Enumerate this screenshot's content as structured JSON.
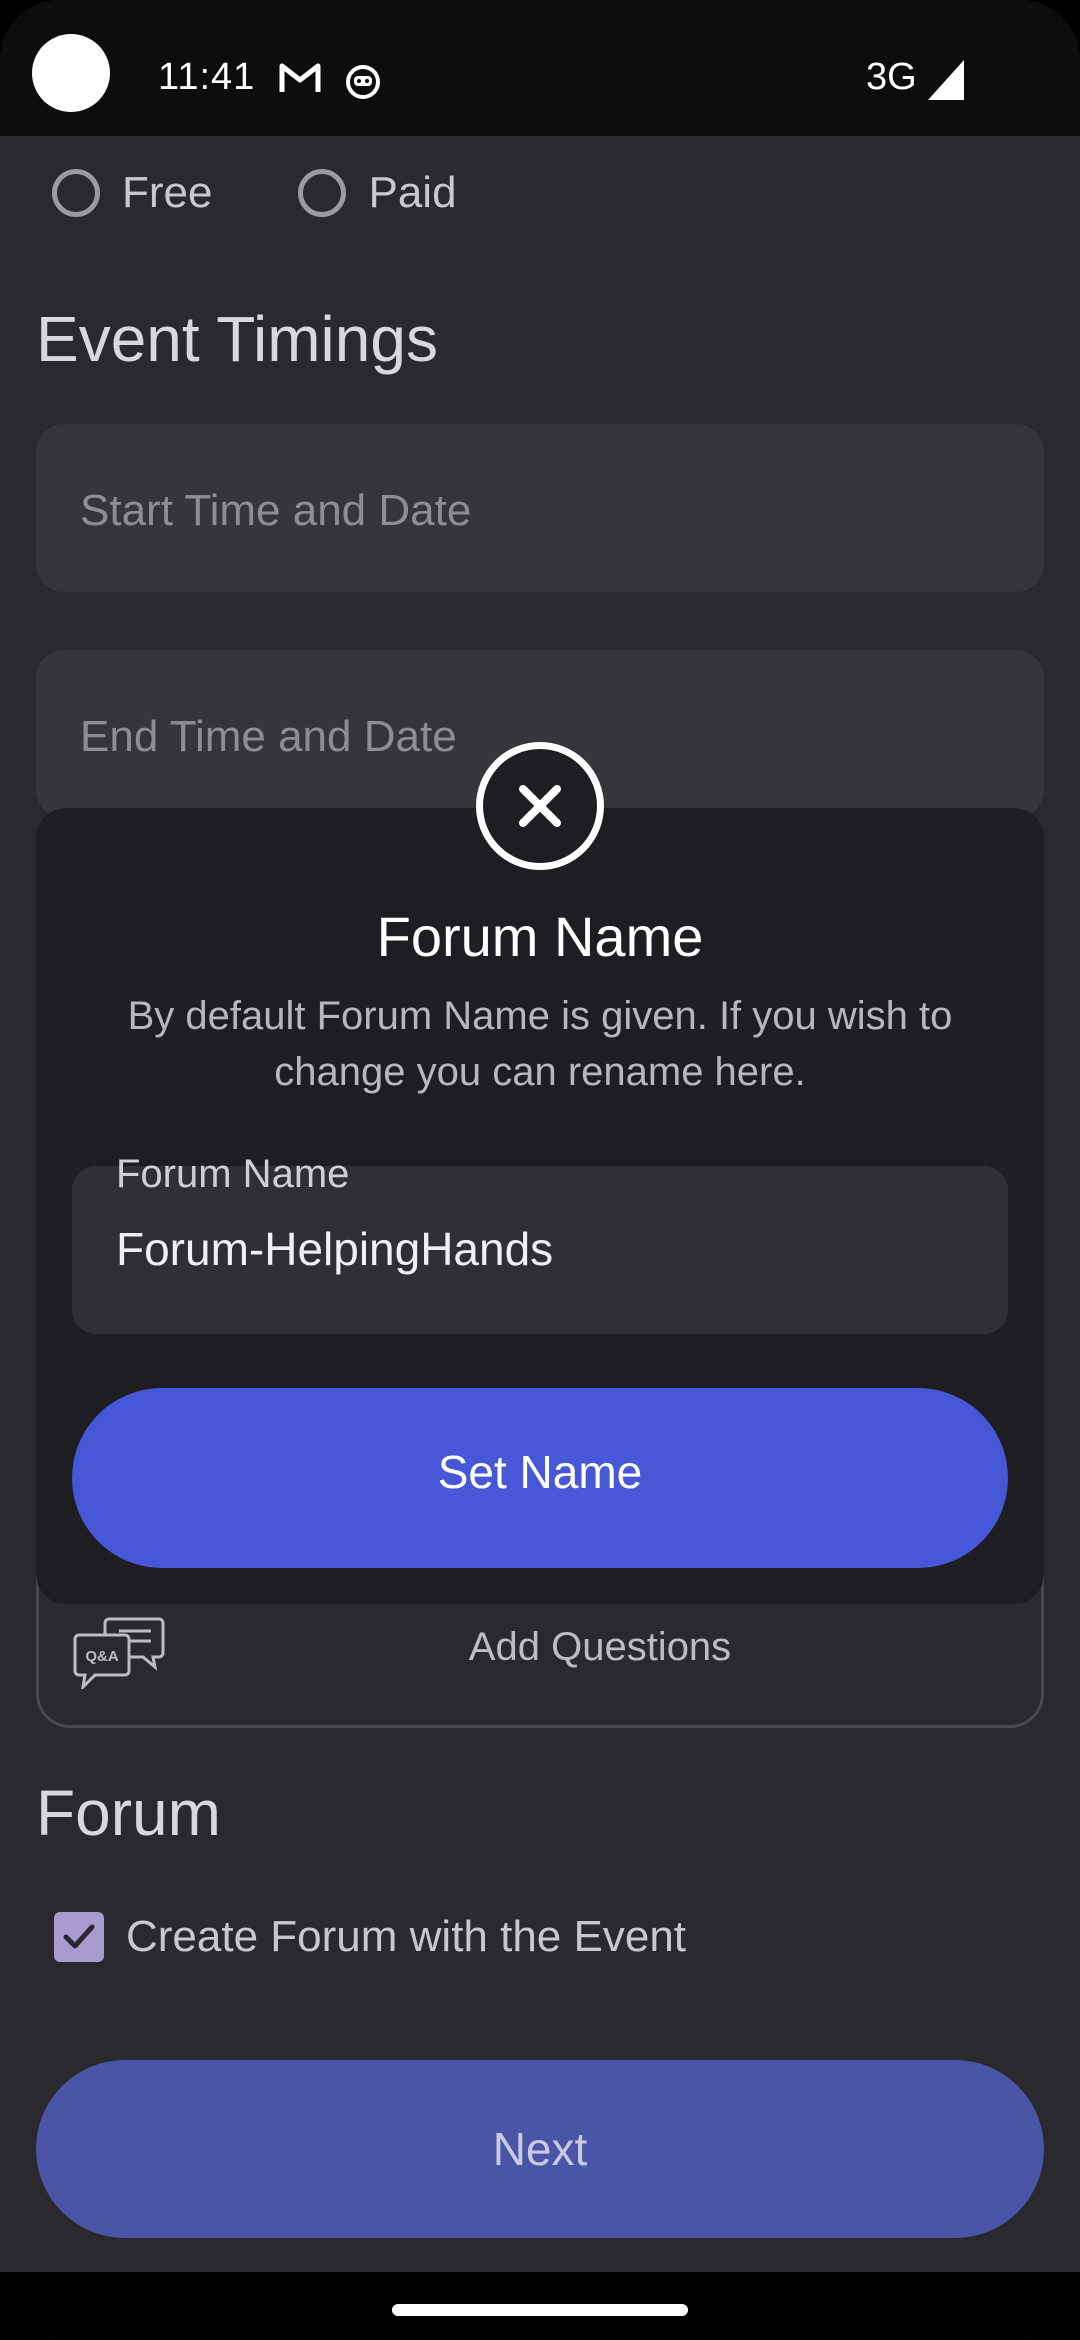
{
  "status_bar": {
    "time": "11:41",
    "network": "3G"
  },
  "pricing": {
    "options": [
      "Free",
      "Paid"
    ]
  },
  "event_timings": {
    "title": "Event Timings",
    "start_placeholder": "Start Time and Date",
    "end_placeholder": "End Time and Date"
  },
  "questions": {
    "icon_text": "Q&A",
    "label": "Add Questions"
  },
  "forum": {
    "title": "Forum",
    "checkbox_label": "Create Forum with the Event",
    "checked": true
  },
  "next_button": {
    "label": "Next"
  },
  "dialog": {
    "title": "Forum Name",
    "description": "By default Forum Name is given. If you wish to change you can rename here.",
    "field_label": "Forum Name",
    "field_value": "Forum-HelpingHands",
    "button_label": "Set Name"
  },
  "colors": {
    "primary_button": "#4658d8",
    "next_button": "#4b55a8",
    "checkbox": "#a89bd0",
    "background": "#2a292e",
    "dialog": "#1e1d21"
  }
}
